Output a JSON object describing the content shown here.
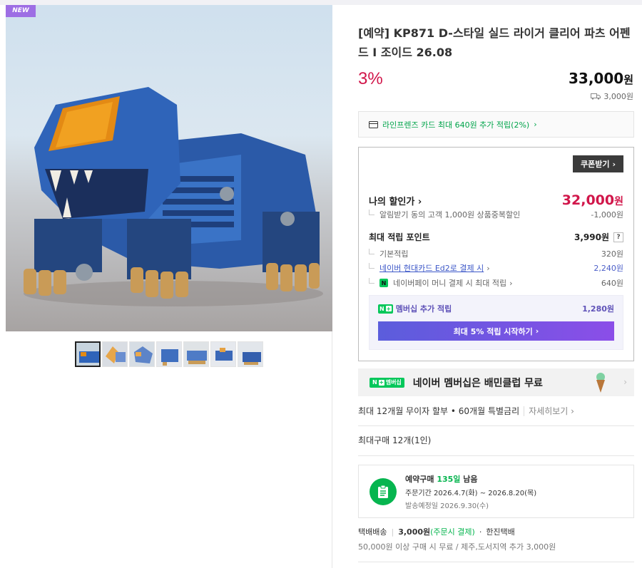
{
  "badge": "NEW",
  "product": {
    "title": "[예약] KP871 D-스타일 실드 라이거 클리어 파츠 어펜드 I 조이드 26.08",
    "discount_rate": "3%",
    "price": "33,000",
    "price_unit": "원",
    "shipping_fee": "3,000원"
  },
  "card_benefit": {
    "text": "라인프렌즈 카드 최대 640원 추가 적립(2%)"
  },
  "benefit_box": {
    "coupon_button": "쿠폰받기",
    "my_discount_label": "나의 할인가",
    "my_discount_price": "32,000",
    "my_discount_unit": "원",
    "alert_label": "알림받기 동의 고객 1,000원 상품중복할인",
    "alert_value": "-1,000원",
    "points_label": "최대 적립 포인트",
    "points_value": "3,990원",
    "points_help": "?",
    "basic_label": "기본적립",
    "basic_value": "320원",
    "card_label": "네이버 현대카드 Ed2로 결제 시",
    "card_value": "2,240원",
    "npay_label": "네이버페이 머니 결제 시 최대 적립",
    "npay_value": "640원",
    "npay_badge": "N",
    "membership_label": "멤버십 추가 적립",
    "membership_value": "1,280원",
    "membership_button": "최대 5% 적립 시작하기"
  },
  "banner": {
    "badge": "멤버십",
    "text": "네이버 멤버십은 배민클럽 무료"
  },
  "installment": {
    "text": "최대 12개월 무이자 할부 • 60개월 특별금리",
    "more": "자세히보기"
  },
  "max_buy": "최대구매 12개(1인)",
  "preorder": {
    "title_prefix": "예약구매",
    "days": "135일",
    "title_suffix": "남음",
    "order_period": "주문기간  2026.4.7(화) ~ 2026.8.20(목)",
    "ship_date": "발송예정일  2026.9.30(수)"
  },
  "delivery": {
    "method": "택배배송",
    "fee": "3,000원",
    "fee_note": "(주문시 결제)",
    "carrier": "한진택배",
    "note": "50,000원 이상 구매 시 무료 / 제주,도서지역 추가 3,000원"
  },
  "colors": {
    "accent_red": "#d1164a",
    "naver_green": "#03c75a",
    "membership_purple": "#5f52b8"
  }
}
